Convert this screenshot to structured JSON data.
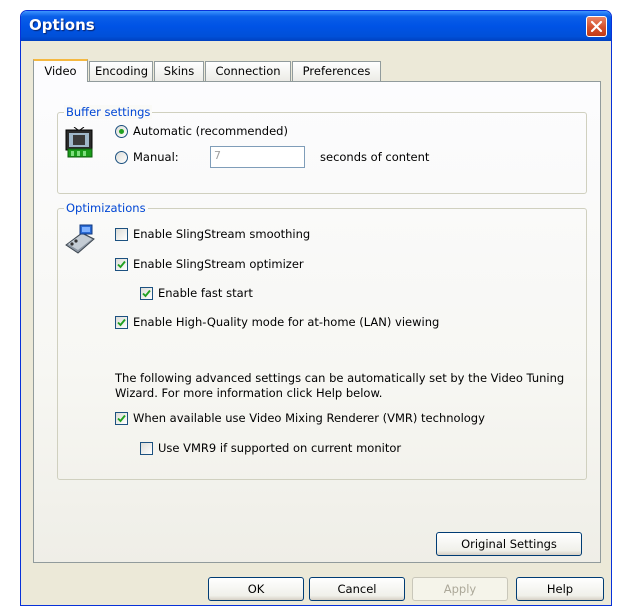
{
  "window": {
    "title": "Options"
  },
  "tabs": [
    "Video",
    "Encoding",
    "Skins",
    "Connection",
    "Preferences"
  ],
  "buffer": {
    "title": "Buffer settings",
    "automatic_label": "Automatic (recommended)",
    "manual_label": "Manual:",
    "manual_value": "7",
    "seconds_label": "seconds of content",
    "selected": "automatic"
  },
  "optimizations": {
    "title": "Optimizations",
    "smoothing_label": "Enable SlingStream smoothing",
    "optimizer_label": "Enable SlingStream optimizer",
    "fast_start_label": "Enable fast start",
    "hq_label": "Enable High-Quality mode for at-home (LAN) viewing",
    "advanced_text": "The following advanced settings can be automatically set by the Video Tuning Wizard.  For more information click Help below.",
    "vmr_label": "When available use Video Mixing Renderer (VMR) technology",
    "vmr9_label": "Use VMR9 if supported on current monitor"
  },
  "checked": {
    "smoothing": false,
    "optimizer": true,
    "fast_start": true,
    "hq": true,
    "vmr": true,
    "vmr9": false
  },
  "buttons": {
    "original_settings": "Original Settings",
    "ok": "OK",
    "cancel": "Cancel",
    "apply": "Apply",
    "help": "Help"
  },
  "icons": {
    "close": "close-icon",
    "buffer": "tv-buffer-icon",
    "optimizations": "network-device-icon"
  }
}
